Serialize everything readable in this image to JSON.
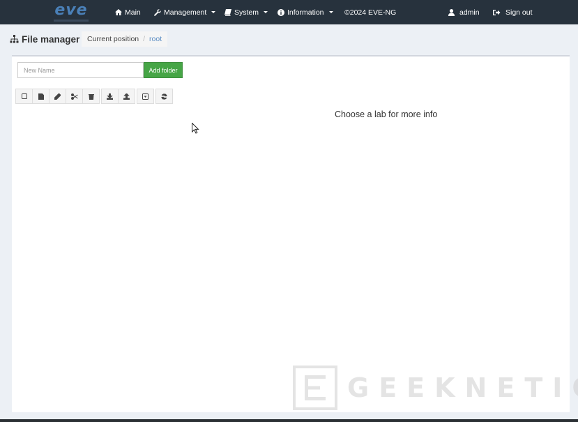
{
  "navbar": {
    "logo_text": "eve",
    "items": [
      {
        "label": "Main",
        "icon": "home-icon"
      },
      {
        "label": "Management",
        "icon": "wrench-icon",
        "dropdown": true
      },
      {
        "label": "System",
        "icon": "book-icon",
        "dropdown": true
      },
      {
        "label": "Information",
        "icon": "info-circle-icon",
        "dropdown": true
      },
      {
        "label": "©2024 EVE-NG"
      }
    ],
    "user": {
      "label": "admin",
      "icon": "user-icon"
    },
    "signout": {
      "label": "Sign out",
      "icon": "sign-out-icon"
    }
  },
  "header": {
    "title": "File manager",
    "icon": "sitemap-icon",
    "breadcrumb": {
      "label": "Current position",
      "separator": "/",
      "current": "root"
    }
  },
  "folder": {
    "placeholder": "New Name",
    "button_label": "Add folder"
  },
  "toolbar": {
    "icons": [
      "checkbox-icon",
      "new-file-icon",
      "pencil-icon",
      "scissors-icon",
      "trash-icon",
      "download-icon",
      "upload-icon",
      "export-icon",
      "refresh-icon"
    ]
  },
  "main": {
    "info_text": "Choose a lab for more info"
  },
  "watermark": {
    "text": "GEEKNETIC"
  },
  "colors": {
    "navbar_bg": "#27323d",
    "page_bg": "#ecf0f5",
    "add_button": "#46a546",
    "link": "#5b8dc3"
  }
}
